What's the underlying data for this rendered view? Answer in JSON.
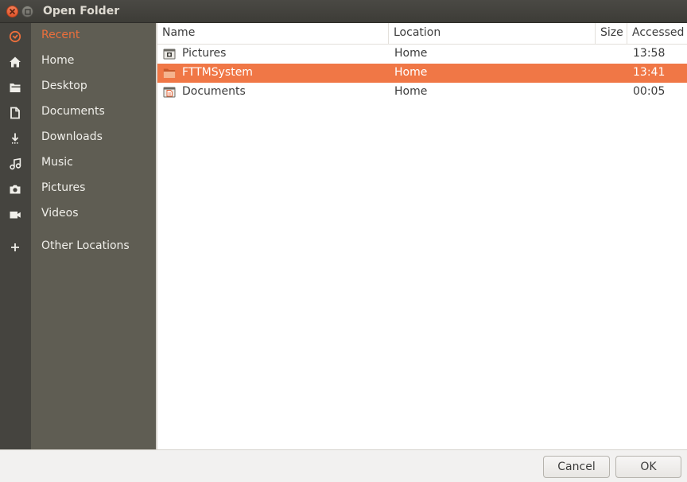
{
  "window": {
    "title": "Open Folder"
  },
  "sidebar": {
    "items": [
      {
        "label": "Recent",
        "icon": "clock-icon",
        "active": true
      },
      {
        "label": "Home",
        "icon": "home-icon"
      },
      {
        "label": "Desktop",
        "icon": "folder-icon"
      },
      {
        "label": "Documents",
        "icon": "document-icon"
      },
      {
        "label": "Downloads",
        "icon": "download-icon"
      },
      {
        "label": "Music",
        "icon": "music-icon"
      },
      {
        "label": "Pictures",
        "icon": "camera-icon"
      },
      {
        "label": "Videos",
        "icon": "video-icon"
      },
      {
        "label": "Other Locations",
        "icon": "plus-icon"
      }
    ]
  },
  "table": {
    "headers": {
      "name": "Name",
      "location": "Location",
      "size": "Size",
      "accessed": "Accessed"
    },
    "rows": [
      {
        "name": "Pictures",
        "location": "Home",
        "size": "",
        "accessed": "13:58",
        "icon": "pictures-folder-icon"
      },
      {
        "name": "FTTMSystem",
        "location": "Home",
        "size": "",
        "accessed": "13:41",
        "icon": "folder-icon",
        "selected": true
      },
      {
        "name": "Documents",
        "location": "Home",
        "size": "",
        "accessed": "00:05",
        "icon": "documents-folder-icon"
      }
    ]
  },
  "footer": {
    "cancel_label": "Cancel",
    "ok_label": "OK"
  },
  "colors": {
    "accent": "#f07746",
    "titlebar": "#3d3c37",
    "sidebar": "#5f5d53",
    "icon_strip": "#45443f"
  }
}
